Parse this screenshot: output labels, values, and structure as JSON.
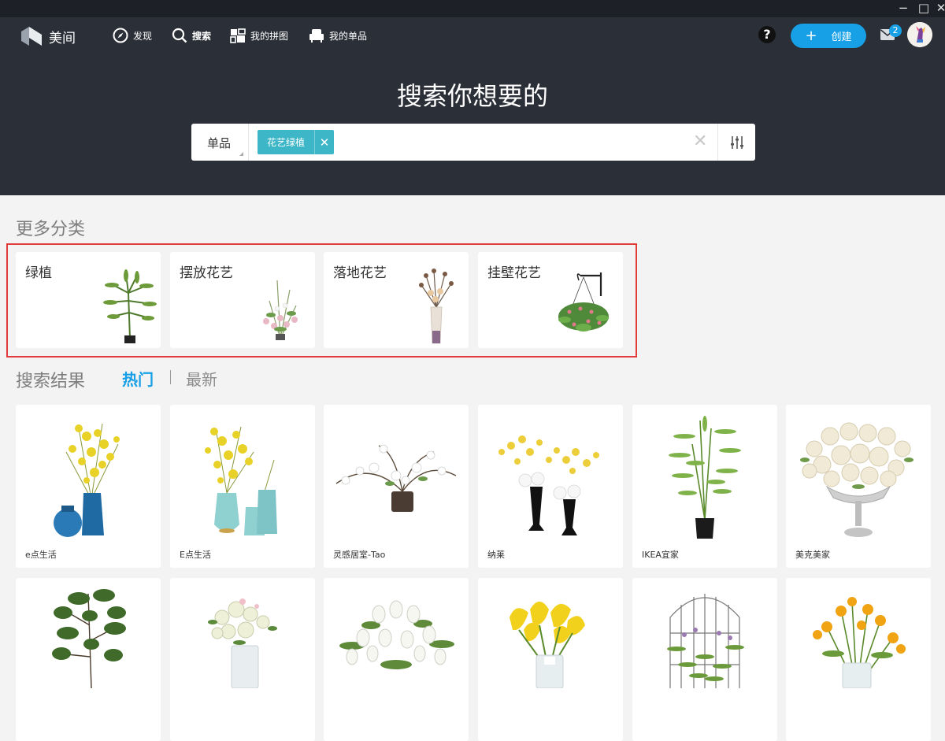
{
  "app": {
    "name": "美间"
  },
  "window_controls": {
    "minimize": "−",
    "maximize": "□",
    "close": "✕"
  },
  "nav": {
    "items": [
      {
        "label": "发现",
        "icon": "compass-icon"
      },
      {
        "label": "搜索",
        "icon": "search-icon"
      },
      {
        "label": "我的拼图",
        "icon": "collage-icon"
      },
      {
        "label": "我的单品",
        "icon": "armchair-icon"
      }
    ],
    "help": "?",
    "create_label": "创建",
    "create_plus": "+",
    "mail_count": "2"
  },
  "hero": {
    "title": "搜索你想要的"
  },
  "search": {
    "type": "单品",
    "tag": "花艺绿植",
    "tag_remove": "✕",
    "clear": "✕"
  },
  "more_categories": {
    "title": "更多分类",
    "items": [
      {
        "label": "绿植"
      },
      {
        "label": "摆放花艺"
      },
      {
        "label": "落地花艺"
      },
      {
        "label": "挂壁花艺"
      }
    ]
  },
  "results": {
    "title": "搜索结果",
    "tabs": {
      "hot": "热门",
      "new": "最新",
      "active": "热门"
    },
    "items": [
      {
        "brand": "e点生活"
      },
      {
        "brand": "E点生活"
      },
      {
        "brand": "灵感居室-Tao"
      },
      {
        "brand": "纳莱"
      },
      {
        "brand": "IKEA宜家"
      },
      {
        "brand": "美克美家"
      },
      {
        "brand": ""
      },
      {
        "brand": ""
      },
      {
        "brand": ""
      },
      {
        "brand": ""
      },
      {
        "brand": ""
      },
      {
        "brand": ""
      }
    ]
  },
  "colors": {
    "header_bg": "#2b2f37",
    "accent": "#17a0e6",
    "tag_bg": "#3db6c7",
    "highlight_frame": "#e23b3b",
    "page_bg": "#f3f3f3"
  }
}
